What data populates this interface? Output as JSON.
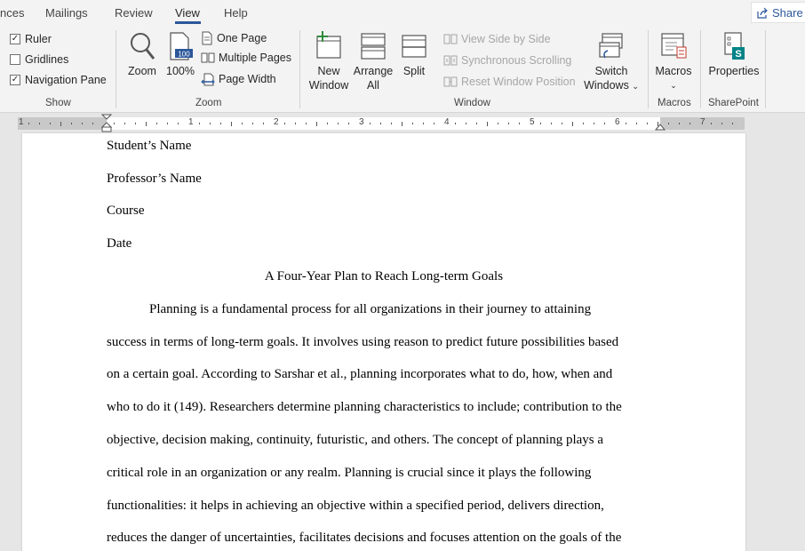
{
  "tabs": {
    "references_partial": "nces",
    "mailings": "Mailings",
    "review": "Review",
    "view": "View",
    "help": "Help",
    "share": "Share"
  },
  "show_group": {
    "label": "Show",
    "ruler": "Ruler",
    "ruler_checked": true,
    "gridlines": "Gridlines",
    "gridlines_checked": false,
    "navigation_pane": "Navigation Pane",
    "navigation_pane_checked": true
  },
  "zoom_group": {
    "label": "Zoom",
    "zoom": "Zoom",
    "hundred": "100%",
    "hundred_badge": "100",
    "one_page": "One Page",
    "multiple_pages": "Multiple Pages",
    "page_width": "Page Width"
  },
  "window_group": {
    "label": "Window",
    "new_window_1": "New",
    "new_window_2": "Window",
    "arrange_all_1": "Arrange",
    "arrange_all_2": "All",
    "split": "Split",
    "view_side_by_side": "View Side by Side",
    "synchronous_scrolling": "Synchronous Scrolling",
    "reset_window_position": "Reset Window Position",
    "switch_windows_1": "Switch",
    "switch_windows_2": "Windows"
  },
  "macros_group": {
    "label": "Macros",
    "macros": "Macros"
  },
  "sharepoint_group": {
    "label": "SharePoint",
    "properties": "Properties"
  },
  "ruler": {
    "numbers": [
      "1",
      "1",
      "2",
      "3",
      "4",
      "5",
      "6",
      "7"
    ]
  },
  "document": {
    "header_lines": [
      "Student’s Name",
      "Professor’s Name",
      "Course",
      "Date"
    ],
    "title": "A Four-Year Plan to Reach Long-term Goals",
    "body_lines": [
      "Planning is a fundamental process for all organizations in their journey to attaining",
      "success in terms of long-term goals. It involves using reason to predict future possibilities based",
      "on a certain goal. According to Sarshar et al., planning incorporates what to do, how, when and",
      "who to do it (149). Researchers determine planning characteristics to include; contribution to the",
      "objective, decision making, continuity, futuristic, and others. The concept of planning plays a",
      "critical role in an organization or any realm. Planning is crucial since it plays the following",
      "functionalities: it helps in achieving an objective within a specified period, delivers direction,",
      "reduces the danger of uncertainties, facilitates decisions and focuses attention on the goals of the"
    ]
  },
  "colors": {
    "accent": "#2b579a",
    "ribbon_bg": "#f3f3f3",
    "disabled_text": "#a6a6a6"
  }
}
